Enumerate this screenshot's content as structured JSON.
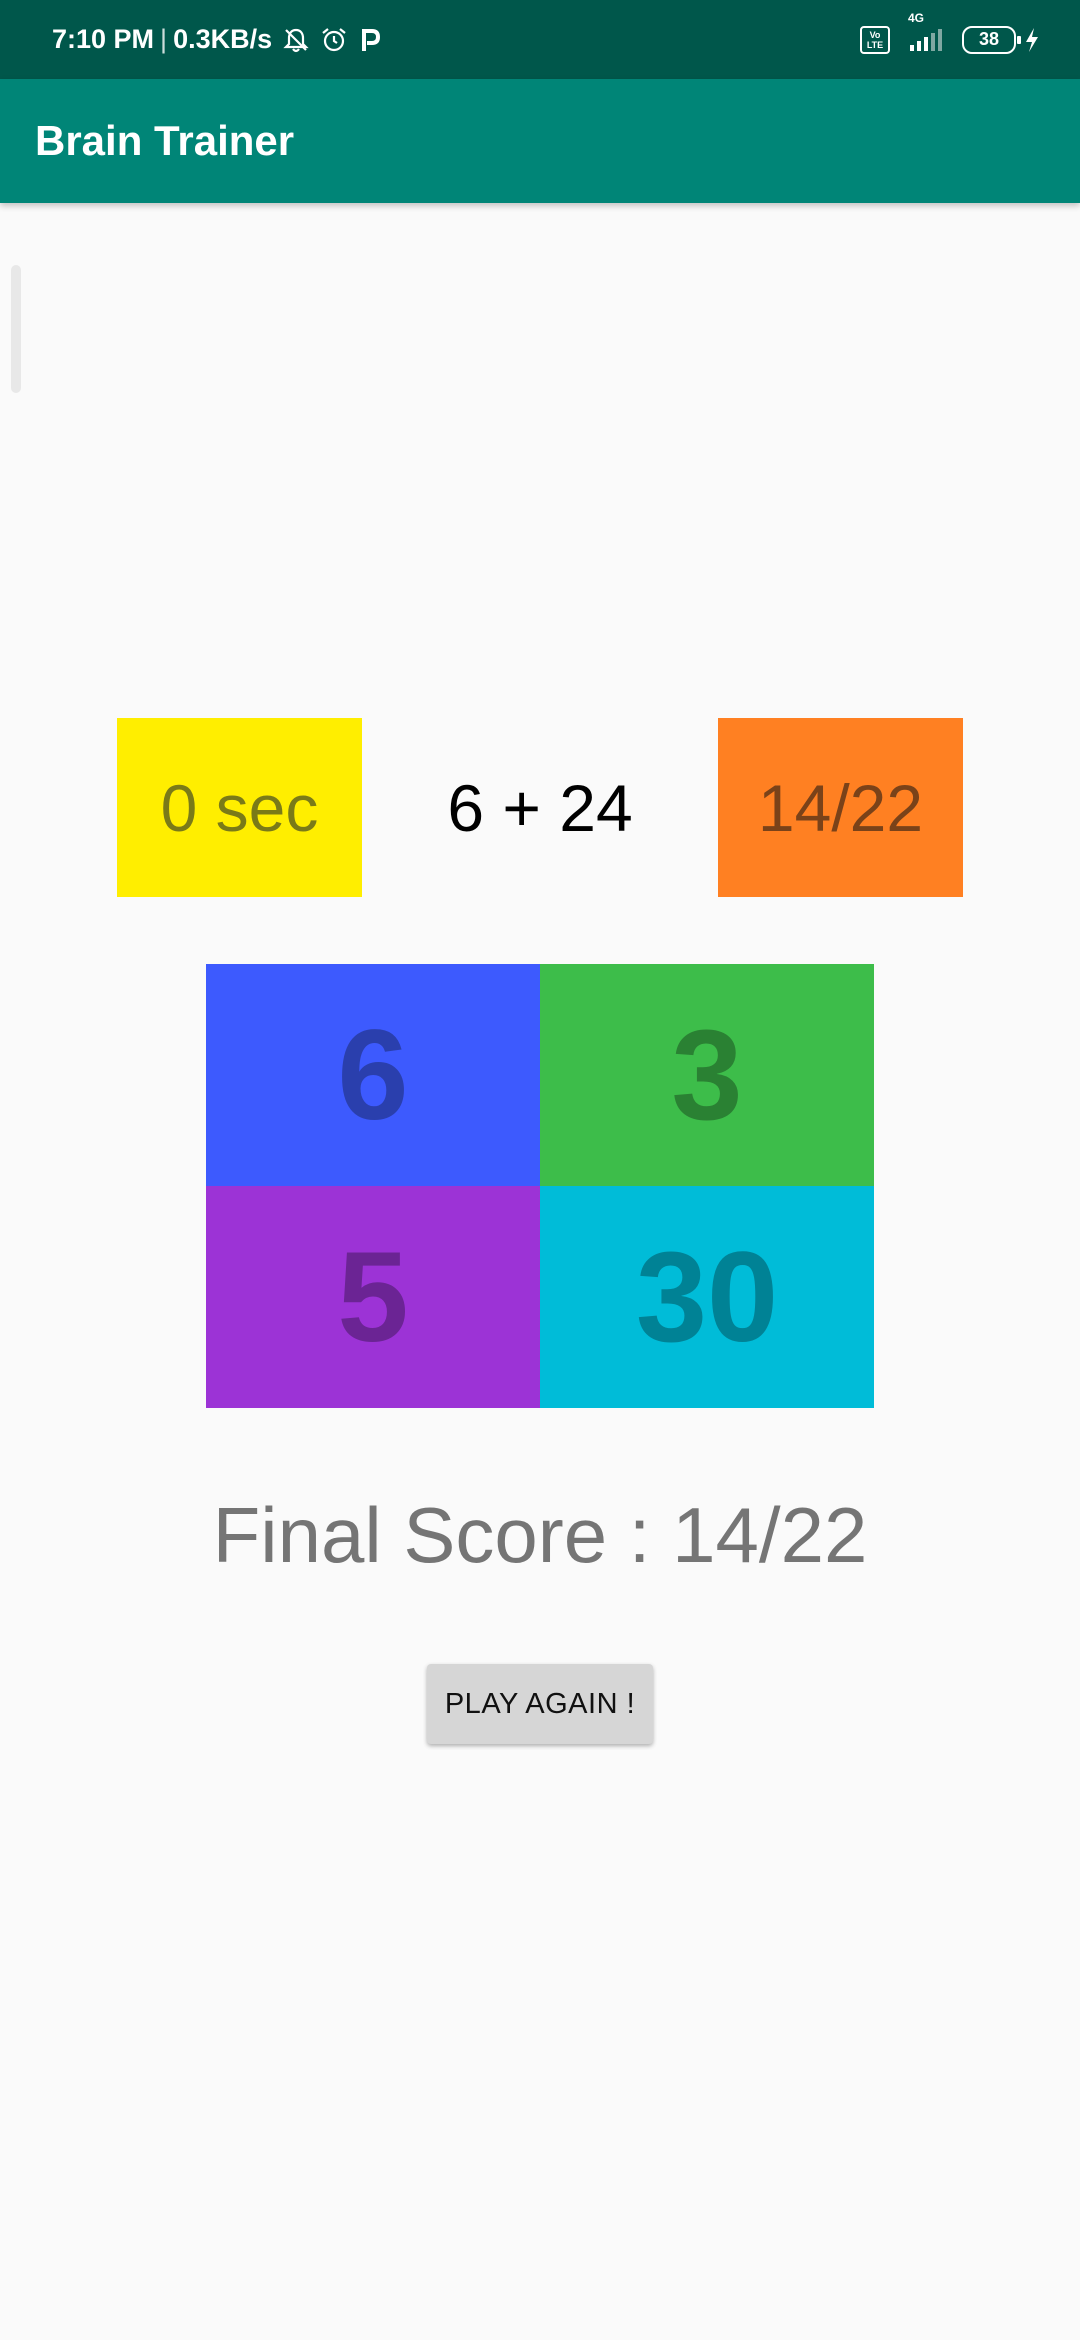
{
  "status_bar": {
    "time": "7:10 PM",
    "network_speed": "0.3KB/s",
    "network_type": "4G",
    "volte_label": "Vo LTE",
    "battery_level": "38",
    "icons": [
      "mute-notifications-icon",
      "alarm-icon",
      "paytm-icon",
      "volte-icon",
      "signal-icon",
      "battery-icon",
      "charging-icon"
    ]
  },
  "app_bar": {
    "title": "Brain Trainer",
    "color": "#008577"
  },
  "game": {
    "timer": "0 sec",
    "question": "6 + 24",
    "score": "14/22",
    "answers": [
      {
        "value": "6",
        "bg": "#3d5afe",
        "fg": "#2a3fad"
      },
      {
        "value": "3",
        "bg": "#3dbd4a",
        "fg": "#2a8133"
      },
      {
        "value": "5",
        "bg": "#9c33d6",
        "fg": "#6b2494"
      },
      {
        "value": "30",
        "bg": "#00bcd8",
        "fg": "#008295"
      }
    ],
    "final_score": "Final Score : 14/22",
    "play_again_label": "PLAY AGAIN !"
  },
  "colors": {
    "timer_bg": "#ffee00",
    "score_bg": "#ff8022",
    "status_bar_bg": "#00574b"
  }
}
